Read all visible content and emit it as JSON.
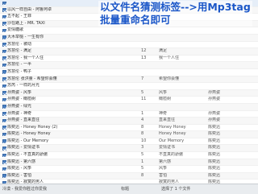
{
  "overlay": {
    "line1": "以文件名猜测标签-->用Mp3tag",
    "line2": "批量重命名即可"
  },
  "rows": [
    {
      "title": "",
      "track": "",
      "album": "",
      "artist": "",
      "checked": true
    },
    {
      "title": "以风一样自由 - 阿鲁阿卓",
      "track": "",
      "album": "",
      "artist": "",
      "checked": true
    },
    {
      "title": "五不起 - 王菲",
      "track": "",
      "album": "",
      "artist": "",
      "checked": true
    },
    {
      "title": "沙在路上 - MR. TAXI",
      "track": "",
      "album": "",
      "artist": "",
      "checked": true
    },
    {
      "title": "爱情糖歌",
      "track": "",
      "album": "",
      "artist": "",
      "checked": true
    },
    {
      "title": "大木举槌 - 一生有你",
      "track": "",
      "album": "",
      "artist": "",
      "checked": true
    },
    {
      "title": "苏慧伦 - 被动",
      "track": "",
      "album": "",
      "artist": "",
      "checked": true
    },
    {
      "title": "苏慧伦 - 满足",
      "track": "12",
      "album": "满足",
      "artist": "",
      "checked": true
    },
    {
      "title": "苏慧伦 - 我一个人住",
      "track": "13",
      "album": "我一个人住",
      "artist": "",
      "checked": true
    },
    {
      "title": "苏慧伦 - 一半",
      "track": "",
      "album": "",
      "artist": "",
      "checked": true
    },
    {
      "title": "苏慧伦 - 鸭子",
      "track": "",
      "album": "",
      "artist": "",
      "checked": true
    },
    {
      "title": "苏慧伦 张洪量 - 希望你会懂",
      "track": "7",
      "album": "希望你会懂",
      "artist": "",
      "checked": true
    },
    {
      "title": "苏芮 - 一样的月光",
      "track": "",
      "album": "",
      "artist": "",
      "checked": true
    },
    {
      "title": "孙燕姿 - 风筝",
      "track": "5",
      "album": "风筝",
      "artist": "孙燕姿",
      "checked": true
    },
    {
      "title": "孙燕姿 - 橄榄树",
      "track": "11",
      "album": "橄榄树",
      "artist": "孙燕姿",
      "checked": true
    },
    {
      "title": "孙燕姿 - 绿光",
      "track": "",
      "album": "",
      "artist": "",
      "checked": true
    },
    {
      "title": "孙燕姿 - 神奇",
      "track": "1",
      "album": "神奇",
      "artist": "孙燕姿",
      "checked": true
    },
    {
      "title": "孙燕姿 - 直来直往",
      "track": "4",
      "album": "直来直往",
      "artist": "孙燕姿",
      "checked": true
    },
    {
      "title": "陈奕迅 - Honey Honey (2)",
      "track": "8",
      "album": "Honey Honey",
      "artist": "陈奕迅",
      "checked": true
    },
    {
      "title": "陈奕迅 - Honey Honey",
      "track": "8",
      "album": "Honey Honey",
      "artist": "陈奕迅",
      "checked": true
    },
    {
      "title": "陈奕迅 - Our Memory",
      "track": "10",
      "album": "Our Memory",
      "artist": "陈奕迅",
      "checked": true
    },
    {
      "title": "陈奕迅 - 爱情证书",
      "track": "3",
      "album": "爱情证书",
      "artist": "陈奕迅",
      "checked": true
    },
    {
      "title": "陈奕迅 - 不直真的骄傲",
      "track": "5",
      "album": "不直真的骄傲",
      "artist": "陈奕迅",
      "checked": true
    },
    {
      "title": "陈奕迅 - 第六感",
      "track": "1",
      "album": "第六感",
      "artist": "陈奕迅",
      "checked": true
    },
    {
      "title": "陈奕迅 - 风筝",
      "track": "5",
      "album": "风筝",
      "artist": "陈奕迅",
      "checked": true
    },
    {
      "title": "陈奕迅 - 害怕",
      "track": "8",
      "album": "害怕",
      "artist": "陈奕迅",
      "checked": true
    },
    {
      "title": "陈奕迅 - 寂寞的男人",
      "track": "",
      "album": "寂寞的男人",
      "artist": "陈奕迅",
      "checked": true
    }
  ],
  "statusbar": {
    "left": "冷漠 - 我爱你胜过你爱我",
    "mid": "标题",
    "right": "选择了 1 个文件"
  }
}
